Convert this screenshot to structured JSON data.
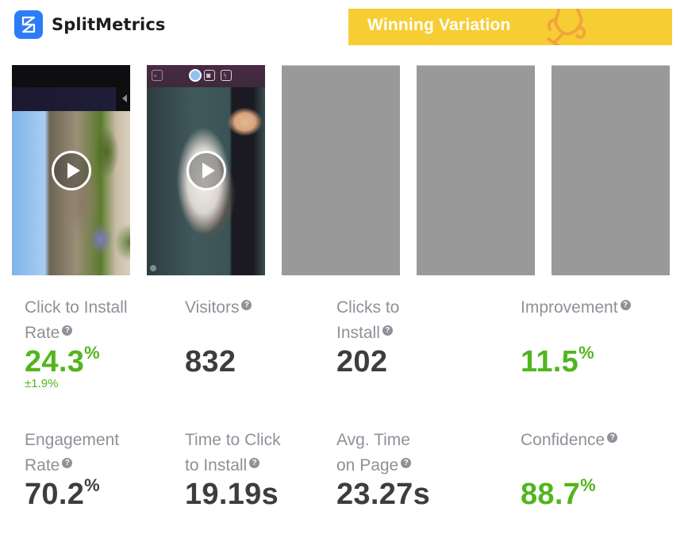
{
  "header": {
    "brand_name": "SplitMetrics",
    "brand_color": "#2b7cf6",
    "badge_label": "Winning Variation",
    "badge_color": "#f7cd34",
    "badge_icon": "trophy-icon"
  },
  "variations": [
    {
      "type": "video",
      "thumbnail": "house-scene",
      "play_icon": "play-icon"
    },
    {
      "type": "video",
      "thumbnail": "kitten-scene",
      "play_icon": "play-icon"
    },
    {
      "type": "placeholder"
    },
    {
      "type": "placeholder"
    },
    {
      "type": "placeholder"
    }
  ],
  "metrics": [
    {
      "id": "click-to-install-rate",
      "label_line1": "Click to Install",
      "label_line2": "Rate",
      "value": "24.3",
      "unit": "%",
      "sub": "±1.9%",
      "color": "green",
      "help_icon": "?"
    },
    {
      "id": "visitors",
      "label_line1": "Visitors",
      "label_line2": "",
      "value": "832",
      "unit": "",
      "color": "dark",
      "help_icon": "?"
    },
    {
      "id": "clicks-to-install",
      "label_line1": "Clicks to",
      "label_line2": "Install",
      "value": "202",
      "unit": "",
      "color": "dark",
      "help_icon": "?"
    },
    {
      "id": "improvement",
      "label_line1": "Improvement",
      "label_line2": "",
      "value": "11.5",
      "unit": "%",
      "color": "green",
      "help_icon": "?"
    },
    {
      "id": "engagement-rate",
      "label_line1": "Engagement",
      "label_line2": "Rate",
      "value": "70.2",
      "unit": "%",
      "color": "dark",
      "help_icon": "?"
    },
    {
      "id": "time-to-click-to-install",
      "label_line1": "Time to Click",
      "label_line2": "to Install",
      "value": "19.19s",
      "unit": "",
      "color": "dark",
      "help_icon": "?"
    },
    {
      "id": "avg-time-on-page",
      "label_line1": "Avg. Time",
      "label_line2": "on Page",
      "value": "23.27s",
      "unit": "",
      "color": "dark",
      "help_icon": "?"
    },
    {
      "id": "confidence",
      "label_line1": "Confidence",
      "label_line2": "",
      "value": "88.7",
      "unit": "%",
      "color": "green",
      "help_icon": "?"
    }
  ],
  "colors": {
    "green": "#52b51d",
    "dark": "#3d3d3f",
    "label": "#8e9198",
    "placeholder": "#999999"
  }
}
